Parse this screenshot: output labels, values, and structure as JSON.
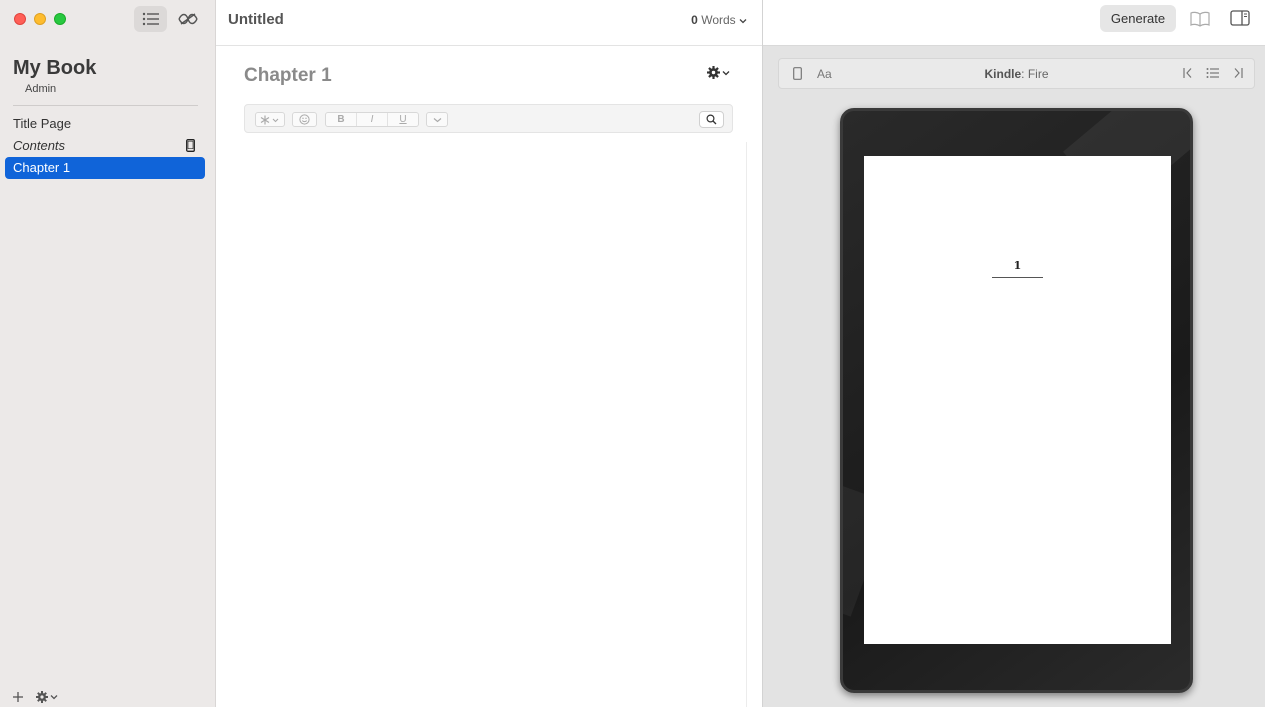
{
  "sidebar": {
    "book_title": "My Book",
    "author": "Admin",
    "items": [
      {
        "label": "Title Page"
      },
      {
        "label": "Contents"
      },
      {
        "label": "Chapter 1"
      }
    ]
  },
  "editor": {
    "doc_title": "Untitled",
    "word_count": "0",
    "word_label": "Words",
    "chapter_title": "Chapter 1",
    "format": {
      "bold": "B",
      "italic": "I",
      "underline": "U"
    }
  },
  "preview": {
    "generate_label": "Generate",
    "aa_label": "Aa",
    "device_brand": "Kindle",
    "device_model": ": Fire",
    "page_number": "1"
  },
  "colors": {
    "selection": "#1064d9",
    "sidebar_bg": "#ece9e8"
  }
}
